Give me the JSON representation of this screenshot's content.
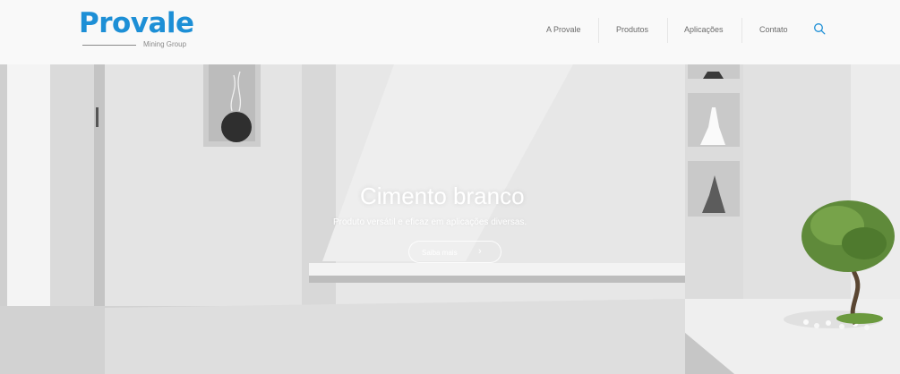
{
  "logo": {
    "brand": "Provale",
    "tagline": "Mining Group"
  },
  "nav": {
    "items": [
      {
        "label": "A Provale"
      },
      {
        "label": "Produtos"
      },
      {
        "label": "Aplicações"
      },
      {
        "label": "Contato"
      }
    ],
    "search_icon": "search-icon"
  },
  "hero": {
    "title": "Cimento branco",
    "subtitle": "Produto versátil e eficaz em aplicações diversas.",
    "button_label": "Saiba mais",
    "button_icon": "chevron-right-icon"
  },
  "colors": {
    "brand_blue": "#1d8fd6",
    "header_bg": "#f9f9f9",
    "nav_text": "#6b6b6b"
  }
}
